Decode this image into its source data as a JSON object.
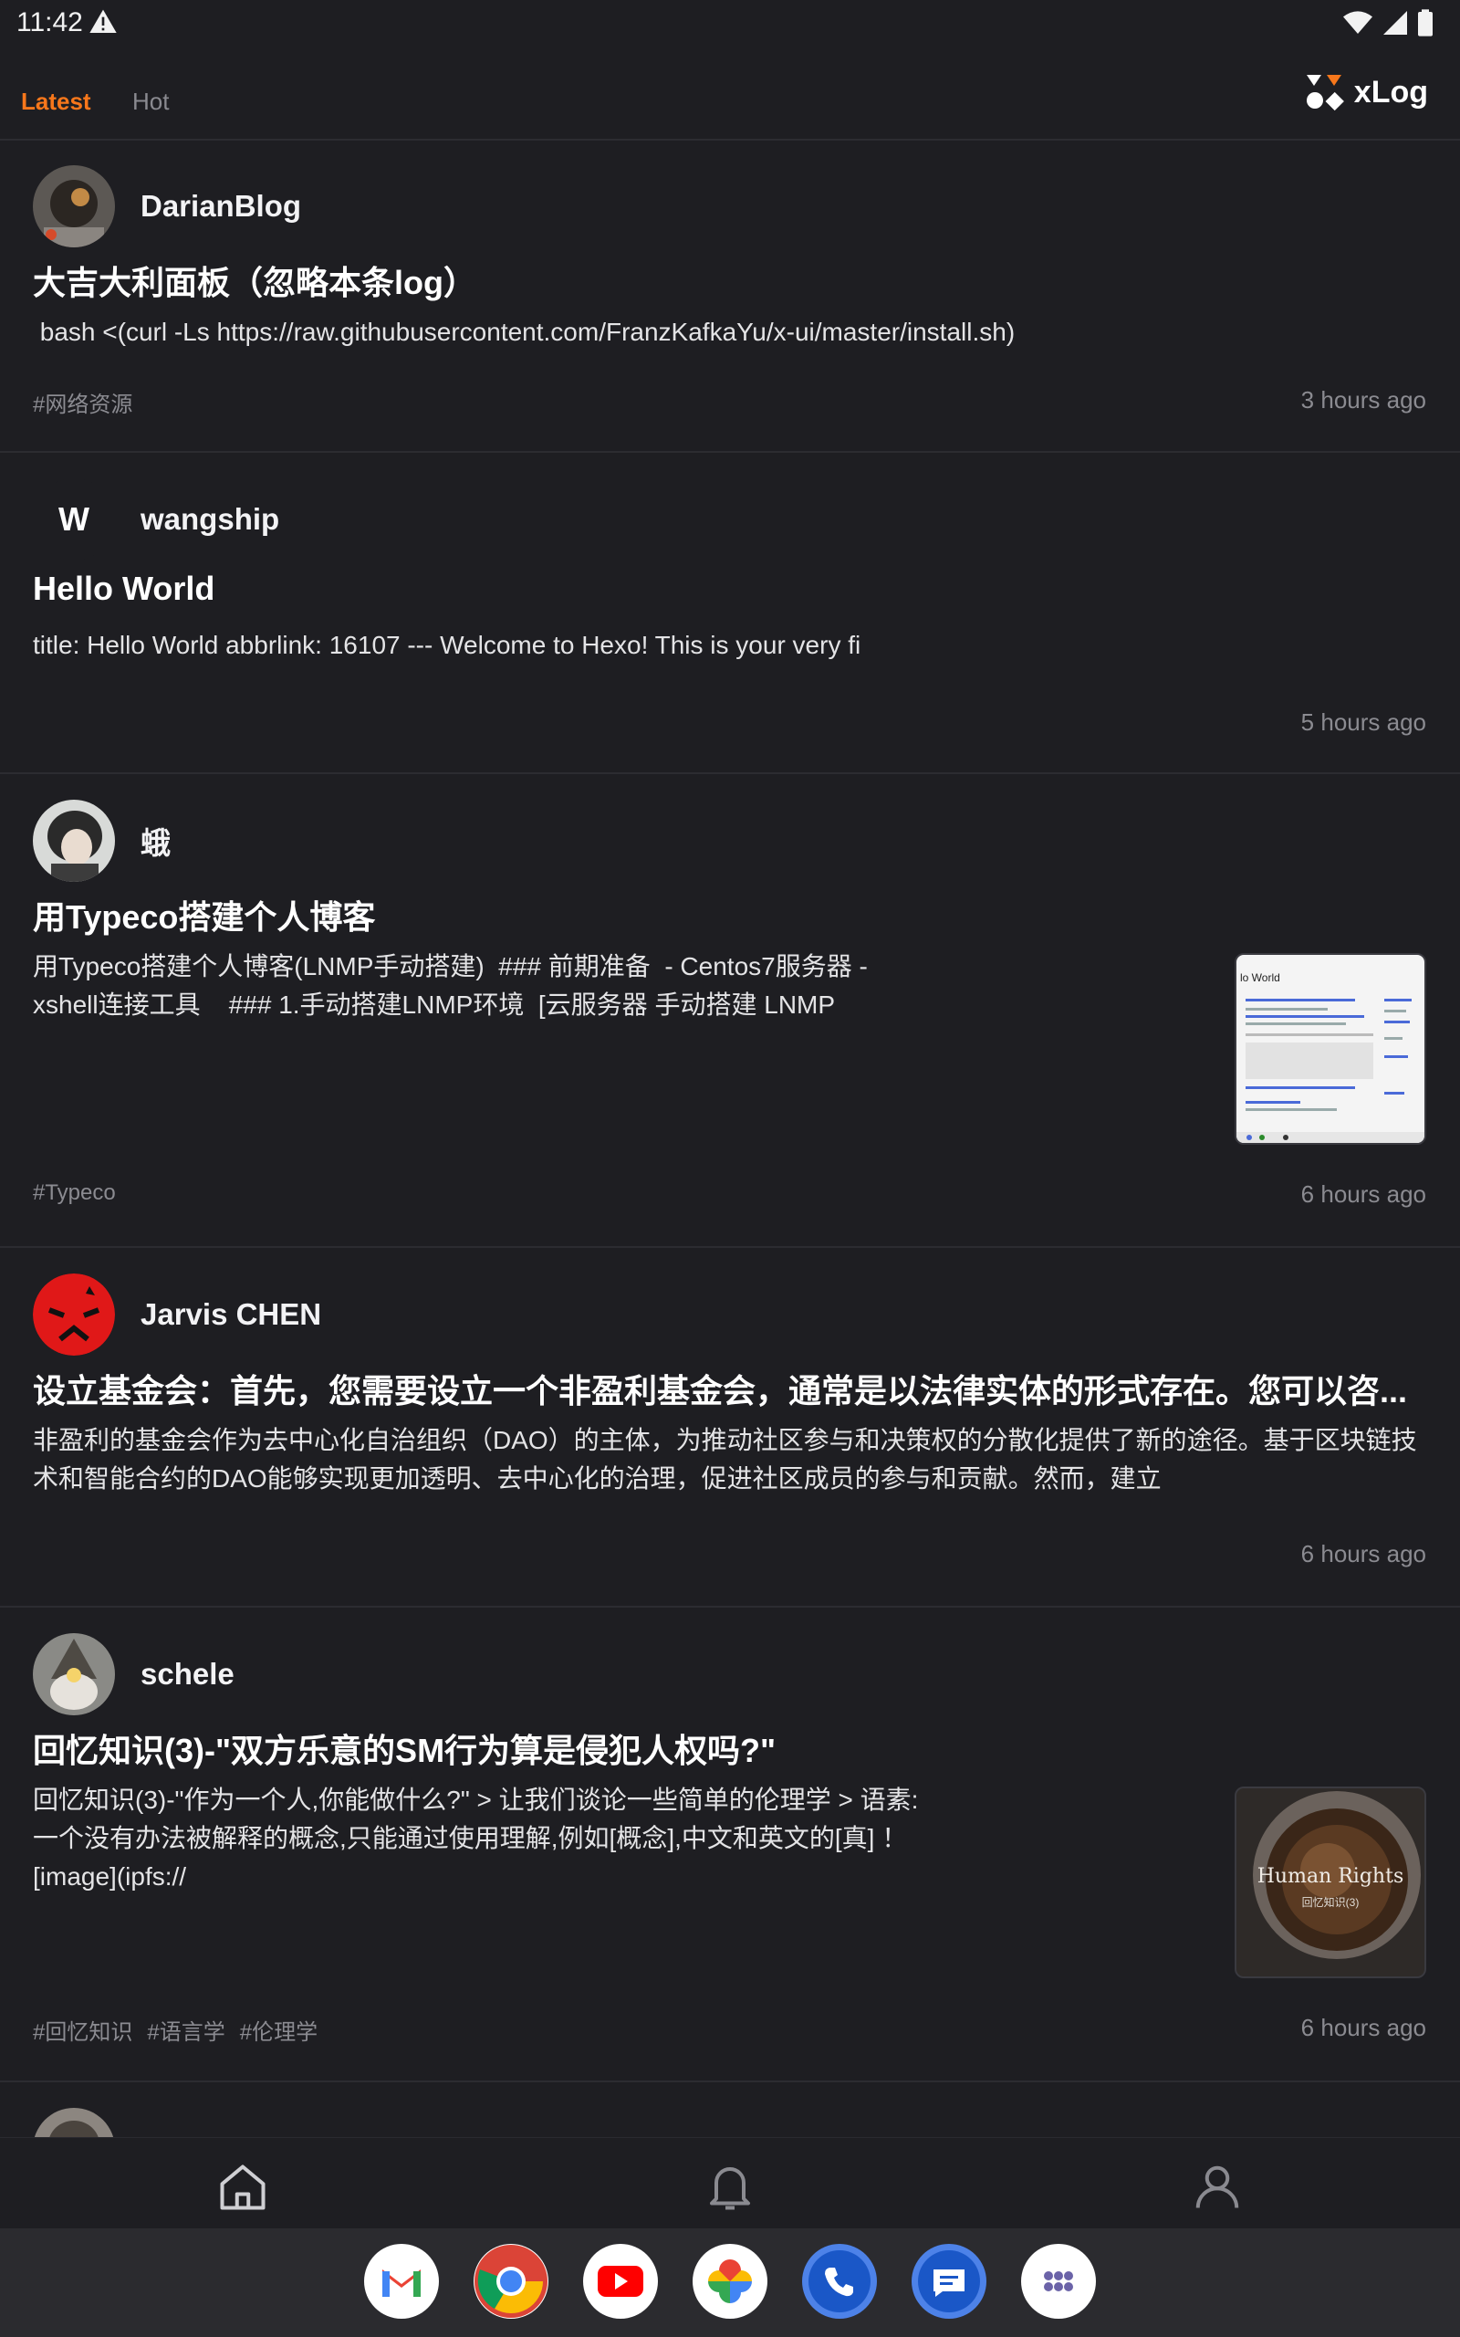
{
  "status_bar": {
    "time": "11:42"
  },
  "top_bar": {
    "tabs": [
      {
        "label": "Latest",
        "active": true
      },
      {
        "label": "Hot",
        "active": false
      }
    ],
    "brand": "xLog",
    "accent_color": "#f7771b"
  },
  "posts": [
    {
      "author": "DarianBlog",
      "title": "大吉大利面板（忽略本条log）",
      "excerpt": " bash <(curl -Ls https://raw.githubusercontent.com/FranzKafkaYu/x-ui/master/install.sh)",
      "tags": [
        "#网络资源"
      ],
      "time_ago": "3 hours ago"
    },
    {
      "author": "wangship",
      "avatar_letter": "W",
      "title": "Hello World",
      "excerpt": "title: Hello World abbrlink: 16107 --- Welcome to Hexo! This is your very fi",
      "tags": [],
      "time_ago": "5 hours ago"
    },
    {
      "author": "蛾",
      "title": "用Typeco搭建个人博客",
      "excerpt_lines": [
        "用Typeco搭建个人博客(LNMP手动搭建)  ### 前期准备  - Centos7服务器 -",
        "xshell连接工具    ### 1.手动搭建LNMP环境  [云服务器 手动搭建 LNMP"
      ],
      "tags": [
        "#Typeco"
      ],
      "time_ago": "6 hours ago",
      "thumbnail_caption": "lo World"
    },
    {
      "author": "Jarvis CHEN",
      "title": "设立基金会：首先，您需要设立一个非盈利基金会，通常是以法律实体的形式存在。您可以咨...",
      "excerpt_lines": [
        "非盈利的基金会作为去中心化自治组织（DAO）的主体，为推动社区参与和决策权的分散化提供了新的途径。基于区块链技",
        "术和智能合约的DAO能够实现更加透明、去中心化的治理，促进社区成员的参与和贡献。然而，建立"
      ],
      "tags": [],
      "time_ago": "6 hours ago"
    },
    {
      "author": "schele",
      "title": "回忆知识(3)-\"双方乐意的SM行为算是侵犯人权吗?\"",
      "excerpt_lines": [
        "回忆知识(3)-\"作为一个人,你能做什么?\" > 让我们谈论一些简单的伦理学 > 语素:",
        "一个没有办法被解释的概念,只能通过使用理解,例如[概念],中文和英文的[真] ！",
        "[image](ipfs://"
      ],
      "tags": [
        "#回忆知识",
        "#语言学",
        "#伦理学"
      ],
      "time_ago": "6 hours ago",
      "thumbnail_title": "Human Rights",
      "thumbnail_subtitle": "回忆知识(3)"
    }
  ],
  "bottom_nav": [
    {
      "icon": "home-icon"
    },
    {
      "icon": "bell-icon"
    },
    {
      "icon": "profile-icon"
    }
  ],
  "dock": [
    {
      "icon": "gmail-icon"
    },
    {
      "icon": "chrome-icon"
    },
    {
      "icon": "youtube-icon"
    },
    {
      "icon": "photos-icon"
    },
    {
      "icon": "phone-icon"
    },
    {
      "icon": "messages-icon"
    },
    {
      "icon": "app-drawer-icon"
    }
  ]
}
